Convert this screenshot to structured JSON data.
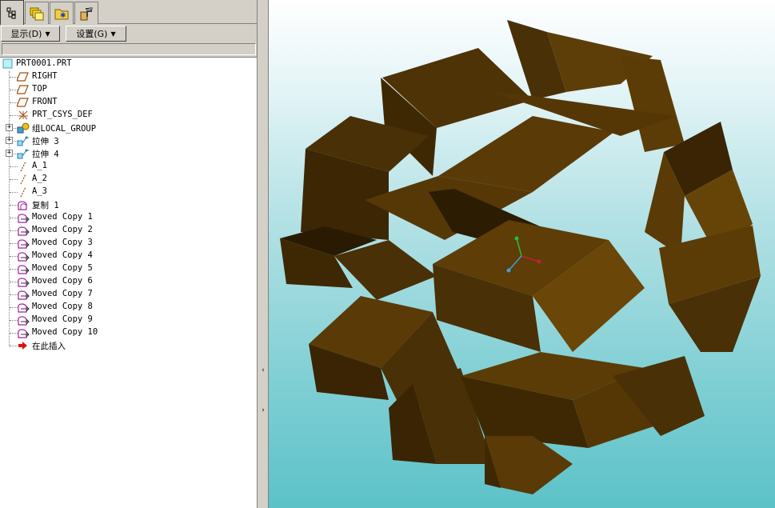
{
  "toolbar_tabs": [
    {
      "icon": "model-tree-icon",
      "active": true
    },
    {
      "icon": "folder-browser-icon",
      "active": false
    },
    {
      "icon": "favorites-icon",
      "active": false
    },
    {
      "icon": "connections-icon",
      "active": false
    }
  ],
  "menu": {
    "show_label": "显示(D)",
    "settings_label": "设置(G)"
  },
  "tree": {
    "root": "PRT0001.PRT",
    "items": [
      {
        "label": "RIGHT",
        "icon": "datum-plane-icon"
      },
      {
        "label": "TOP",
        "icon": "datum-plane-icon"
      },
      {
        "label": "FRONT",
        "icon": "datum-plane-icon"
      },
      {
        "label": "PRT_CSYS_DEF",
        "icon": "csys-icon"
      },
      {
        "label": "组LOCAL_GROUP",
        "icon": "group-icon",
        "expandable": true
      },
      {
        "label": "拉伸 3",
        "icon": "extrude-icon",
        "expandable": true
      },
      {
        "label": "拉伸 4",
        "icon": "extrude-icon",
        "expandable": true
      },
      {
        "label": "A_1",
        "icon": "datum-axis-icon"
      },
      {
        "label": "A_2",
        "icon": "datum-axis-icon"
      },
      {
        "label": "A_3",
        "icon": "datum-axis-icon"
      },
      {
        "label": "复制 1",
        "icon": "copy-icon"
      },
      {
        "label": "Moved Copy 1",
        "icon": "moved-copy-icon"
      },
      {
        "label": "Moved Copy 2",
        "icon": "moved-copy-icon"
      },
      {
        "label": "Moved Copy 3",
        "icon": "moved-copy-icon"
      },
      {
        "label": "Moved Copy 4",
        "icon": "moved-copy-icon"
      },
      {
        "label": "Moved Copy 5",
        "icon": "moved-copy-icon"
      },
      {
        "label": "Moved Copy 6",
        "icon": "moved-copy-icon"
      },
      {
        "label": "Moved Copy 7",
        "icon": "moved-copy-icon"
      },
      {
        "label": "Moved Copy 8",
        "icon": "moved-copy-icon"
      },
      {
        "label": "Moved Copy 9",
        "icon": "moved-copy-icon"
      },
      {
        "label": "Moved Copy 10",
        "icon": "moved-copy-icon"
      },
      {
        "label": "在此插入",
        "icon": "insert-here-arrow-icon"
      }
    ]
  },
  "splitter": {
    "collapse_glyph": "‹",
    "expand_glyph": "›"
  },
  "colors": {
    "model_top": "#5a3a08",
    "model_side": "#3e2804",
    "model_dark": "#2a1a02",
    "model_light": "#6b4808",
    "axis_x": "#c0203a",
    "axis_y": "#20c040",
    "axis_z": "#40a0e0"
  }
}
